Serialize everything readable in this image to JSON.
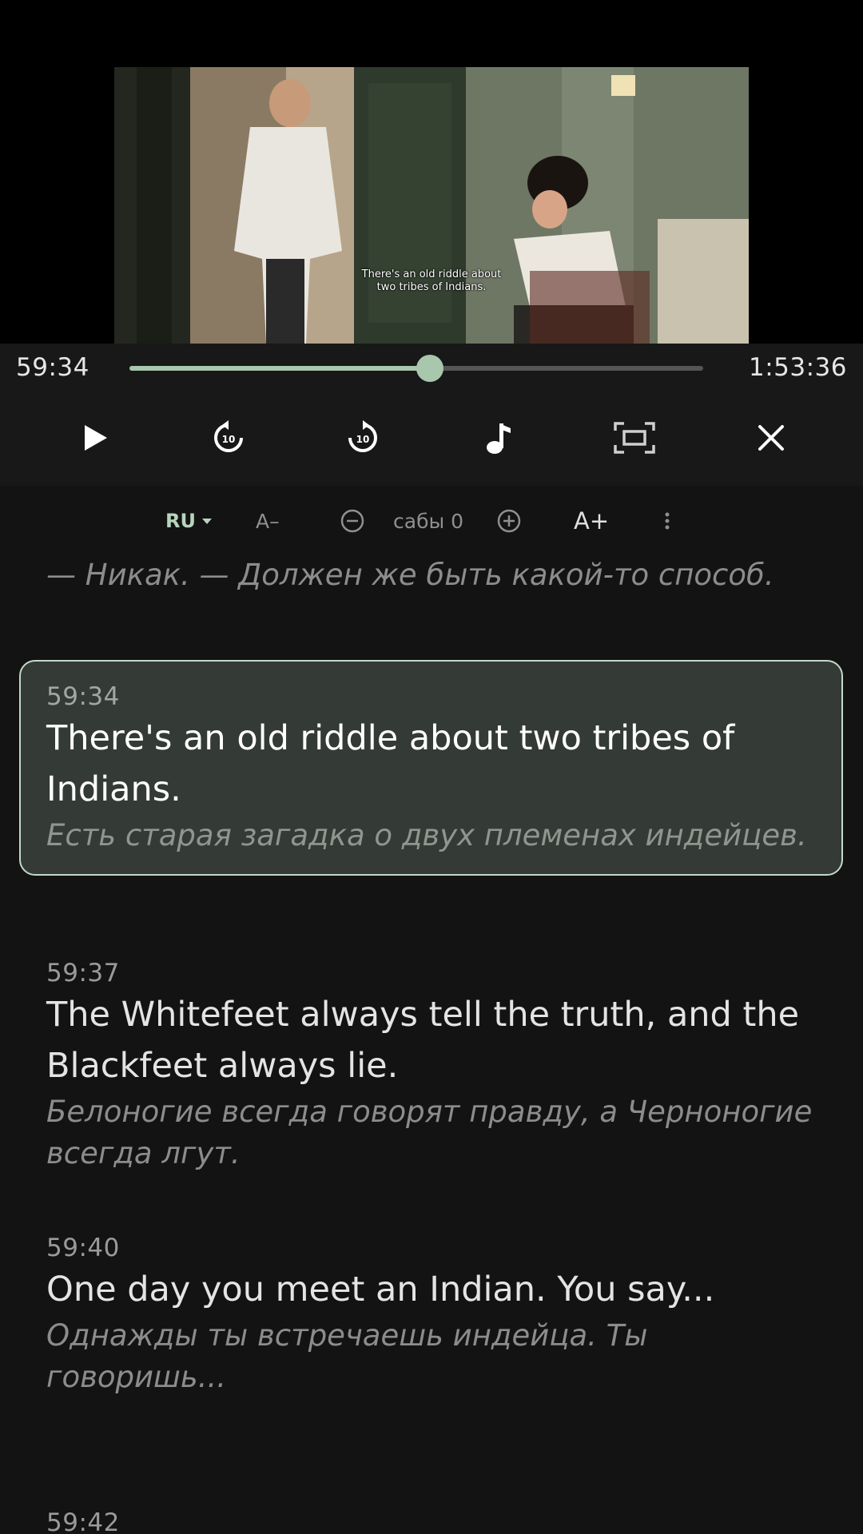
{
  "video": {
    "burned_subtitle_line1": "There's an old riddle about",
    "burned_subtitle_line2": "two tribes of Indians."
  },
  "player": {
    "current_time": "59:34",
    "total_time": "1:53:36",
    "progress_fraction": 0.524,
    "accent_color": "#a8c7ad"
  },
  "controls": [
    {
      "name": "play-icon"
    },
    {
      "name": "replay-10-icon"
    },
    {
      "name": "forward-10-icon"
    },
    {
      "name": "music-note-icon"
    },
    {
      "name": "fullscreen-icon"
    },
    {
      "name": "close-icon"
    }
  ],
  "toolbar": {
    "language": "RU",
    "font_decrease": "A–",
    "subtitle_offset": "сабы 0",
    "font_increase": "A+"
  },
  "cues": [
    {
      "time": "",
      "en": "",
      "ru": "— Никак. — Должен же быть какой-то способ."
    },
    {
      "time": "59:34",
      "en": "There's an old riddle about two tribes of Indians.",
      "ru": "Есть старая загадка о двух племенах индейцев.",
      "active": true
    },
    {
      "time": "59:37",
      "en": "The Whitefeet always tell the truth, and the Blackfeet always lie.",
      "ru": "Белоногие всегда говорят правду, а Черноногие всегда лгут."
    },
    {
      "time": "59:40",
      "en": "One day you meet an Indian. You say...",
      "ru": "Однажды ты встречаешь индейца. Ты говоришь..."
    },
    {
      "time": "59:42",
      "en": "",
      "ru": ""
    }
  ]
}
